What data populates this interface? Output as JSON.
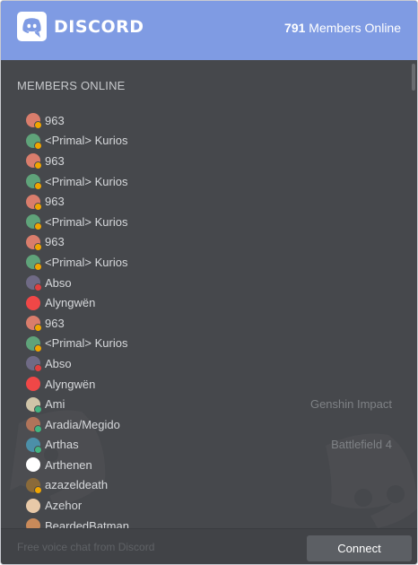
{
  "header": {
    "brand": "DISCORD",
    "online_count": "791",
    "online_label": " Members Online",
    "brand_color": "#7f9be3",
    "logo_icon": "discord-logo-icon"
  },
  "section_title": "MEMBERS ONLINE",
  "members": [
    {
      "name": "963",
      "game": "",
      "avatar": "#d97d6c",
      "status": "#f0a500"
    },
    {
      "name": "<Primal> Kurios",
      "game": "",
      "avatar": "#5fa37a",
      "status": "#f0a500"
    },
    {
      "name": "963",
      "game": "",
      "avatar": "#d97d6c",
      "status": "#f0a500"
    },
    {
      "name": "<Primal> Kurios",
      "game": "",
      "avatar": "#5fa37a",
      "status": "#f0a500"
    },
    {
      "name": "963",
      "game": "",
      "avatar": "#d97d6c",
      "status": "#f0a500"
    },
    {
      "name": "<Primal> Kurios",
      "game": "",
      "avatar": "#5fa37a",
      "status": "#f0a500"
    },
    {
      "name": "963",
      "game": "",
      "avatar": "#d97d6c",
      "status": "#f0a500"
    },
    {
      "name": "<Primal> Kurios",
      "game": "",
      "avatar": "#5fa37a",
      "status": "#f0a500"
    },
    {
      "name": "Abso",
      "game": "",
      "avatar": "#6f6a85",
      "status": "#e04040"
    },
    {
      "name": "Alyngwën",
      "game": "",
      "avatar": "#f04747",
      "status": ""
    },
    {
      "name": "963",
      "game": "",
      "avatar": "#d97d6c",
      "status": "#f0a500"
    },
    {
      "name": "<Primal> Kurios",
      "game": "",
      "avatar": "#5fa37a",
      "status": "#f0a500"
    },
    {
      "name": "Abso",
      "game": "",
      "avatar": "#6f6a85",
      "status": "#e04040"
    },
    {
      "name": "Alyngwën",
      "game": "",
      "avatar": "#f04747",
      "status": ""
    },
    {
      "name": "Ami",
      "game": "Genshin Impact",
      "avatar": "#cfc4a8",
      "status": "#43b581"
    },
    {
      "name": "Aradia/Megido",
      "game": "",
      "avatar": "#b0745a",
      "status": "#43b581"
    },
    {
      "name": "Arthas",
      "game": "Battlefield 4",
      "avatar": "#4c8fa8",
      "status": "#43b581"
    },
    {
      "name": "Arthenen",
      "game": "",
      "avatar": "#ffffff",
      "status": ""
    },
    {
      "name": "azazeldeath",
      "game": "",
      "avatar": "#8a6a3a",
      "status": "#f0a500"
    },
    {
      "name": "Azehor",
      "game": "",
      "avatar": "#e8c9a8",
      "status": ""
    },
    {
      "name": "BeardedBatman",
      "game": "",
      "avatar": "#c98a5a",
      "status": ""
    }
  ],
  "footer": {
    "tagline": "Free voice chat from Discord",
    "connect_label": "Connect"
  }
}
